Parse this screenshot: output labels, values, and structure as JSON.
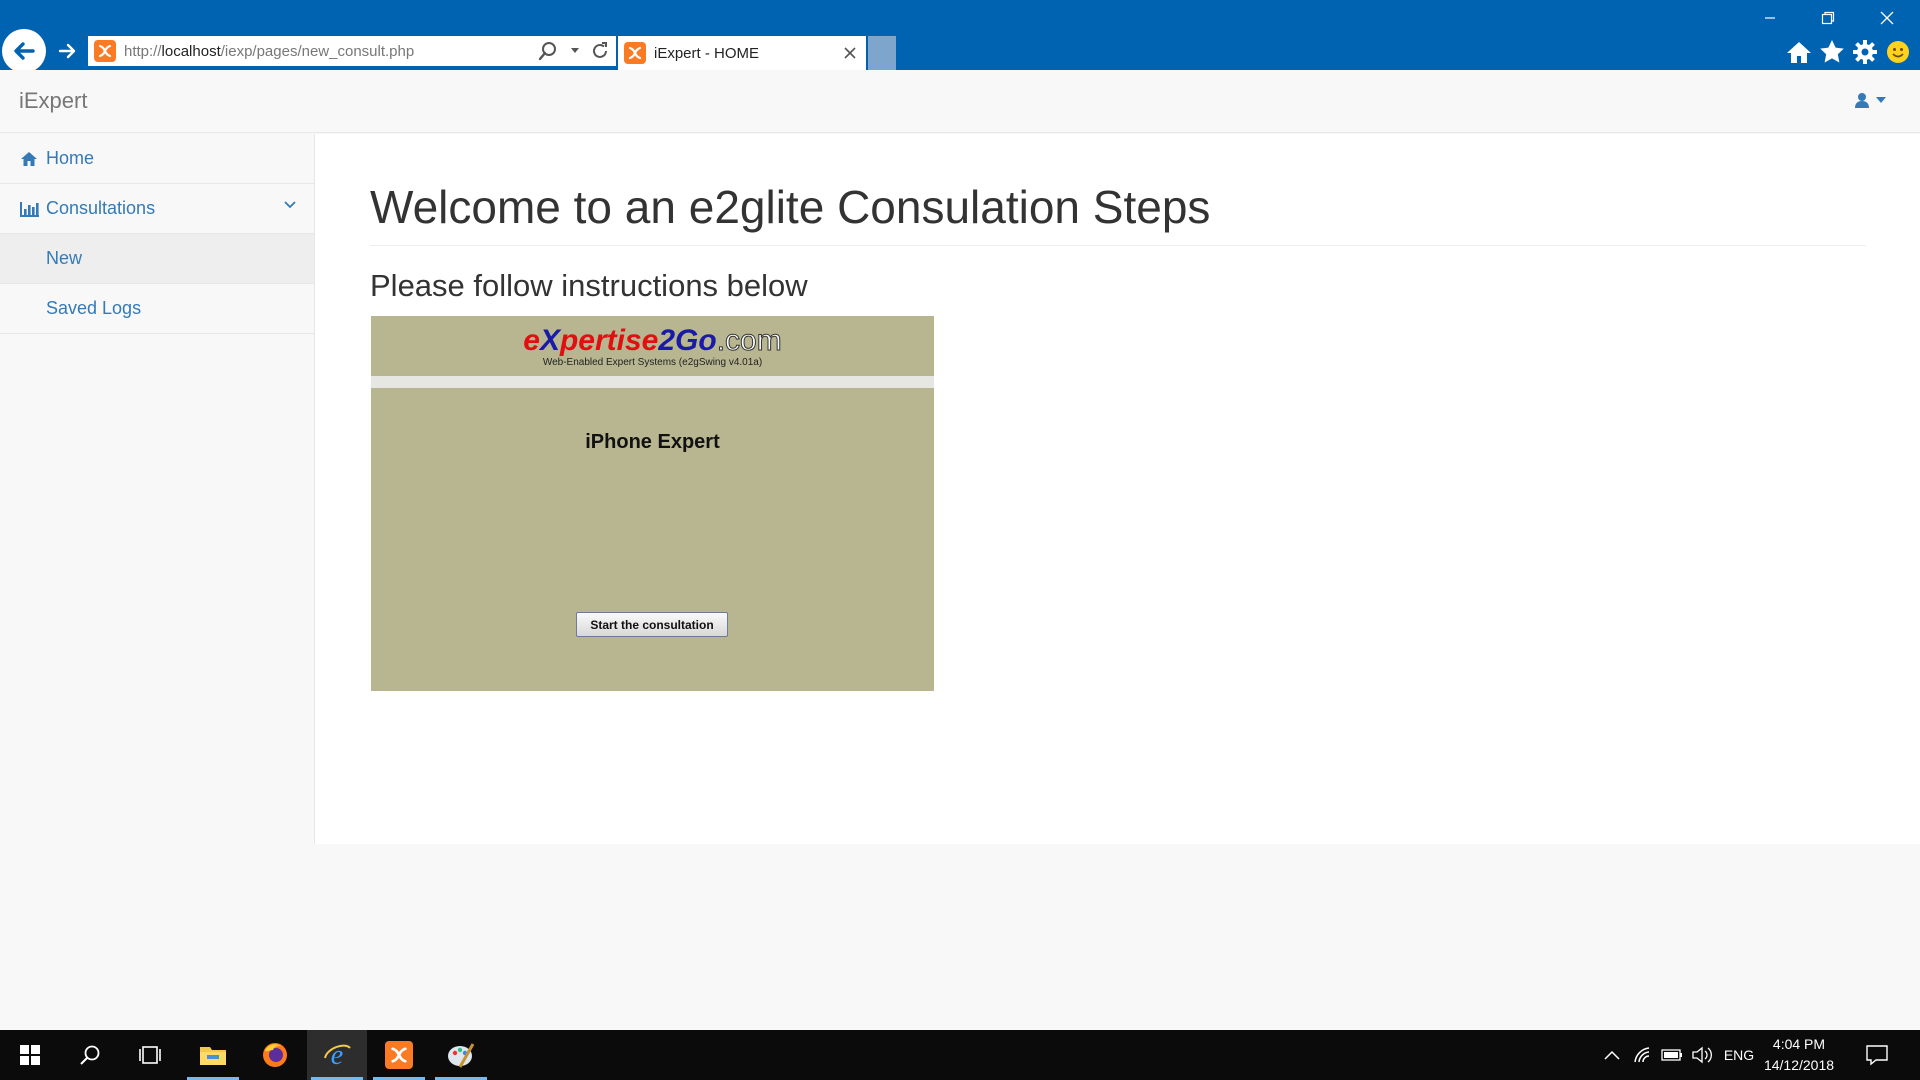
{
  "browser": {
    "url_prefix": "http://",
    "url_host": "localhost",
    "url_path": "/iexp/pages/new_consult.php",
    "tab_title": "iExpert - HOME",
    "icons": [
      "back-icon",
      "forward-icon",
      "search-icon",
      "refresh-icon",
      "home-icon",
      "star-icon",
      "gear-icon",
      "smiley-icon",
      "minimize-icon",
      "restore-icon",
      "close-icon"
    ]
  },
  "navbar": {
    "brand": "iExpert",
    "user_icon": "user-icon"
  },
  "sidebar": {
    "items": [
      {
        "label": "Home",
        "icon": "home-icon"
      },
      {
        "label": "Consultations",
        "icon": "bar-chart-icon"
      }
    ],
    "sub_items": [
      {
        "label": "New",
        "active": true
      },
      {
        "label": "Saved Logs",
        "active": false
      }
    ]
  },
  "main": {
    "title": "Welcome to an e2glite Consulation Steps",
    "subtitle": "Please follow instructions below"
  },
  "applet": {
    "logo_e": "e",
    "logo_x": "X",
    "logo_pertise": "pertise",
    "logo_2": "2",
    "logo_go": "Go",
    "logo_com": ".com",
    "logo_sub": "Web-Enabled Expert Systems (e2gSwing v4.01a)",
    "expert_title": "iPhone Expert",
    "start_button": "Start the consultation"
  },
  "taskbar": {
    "language": "ENG",
    "time": "4:04 PM",
    "date": "14/12/2018",
    "apps": [
      "windows-start-icon",
      "search-icon",
      "task-view-icon",
      "file-explorer-icon",
      "firefox-icon",
      "internet-explorer-icon",
      "xampp-icon",
      "paint-icon"
    ]
  },
  "colors": {
    "chrome_blue": "#0063b1",
    "link_blue": "#337ab7",
    "applet_bg": "#b8b690"
  }
}
